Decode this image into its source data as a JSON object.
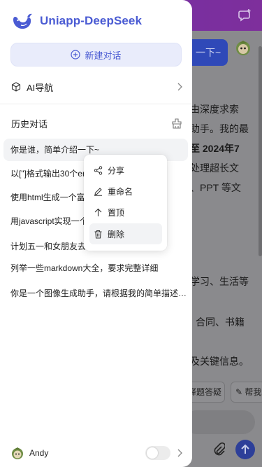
{
  "app": {
    "title": "Uniapp-DeepSeek"
  },
  "drawer": {
    "new_chat_label": "新建对话",
    "nav_label": "AI导航",
    "history_label": "历史对话",
    "history_items": [
      "你是谁，简单介绍一下~",
      "以[\"]格式输出30个em",
      "使用html生成一个富",
      "用javascript实现一个",
      "计划五一和女朋友去",
      "列举一些markdown大全，要求完整详细",
      "你是一个图像生成助手，请根据我的简单描述生成图片"
    ],
    "user_name": "Andy"
  },
  "context_menu": {
    "items": [
      {
        "label": "分享",
        "icon": "share-icon"
      },
      {
        "label": "重命名",
        "icon": "pencil-icon"
      },
      {
        "label": "置顶",
        "icon": "arrow-up-icon"
      },
      {
        "label": "删除",
        "icon": "trash-icon"
      }
    ]
  },
  "background_chat": {
    "user_message": "一下~",
    "answer_lines": [
      "由深度求索",
      "助手。我的最",
      "至 2024年7",
      "处理超长文",
      "、PPT 等文",
      "",
      "",
      "学习、生活等",
      "",
      "合同、书籍",
      "",
      "及关键信息。"
    ],
    "suggestion_chips": [
      "释题答疑",
      "帮我"
    ]
  },
  "colors": {
    "brand": "#4a5bd3",
    "header_gradient_start": "#6d2ea8",
    "header_gradient_end": "#7e2f9c",
    "overlay": "#8a8a8d",
    "drawer_bg": "#ffffff",
    "new_chat_bg": "#e9ecfb",
    "active_item_bg": "#f2f3f5"
  },
  "toggle": {
    "on": false
  }
}
